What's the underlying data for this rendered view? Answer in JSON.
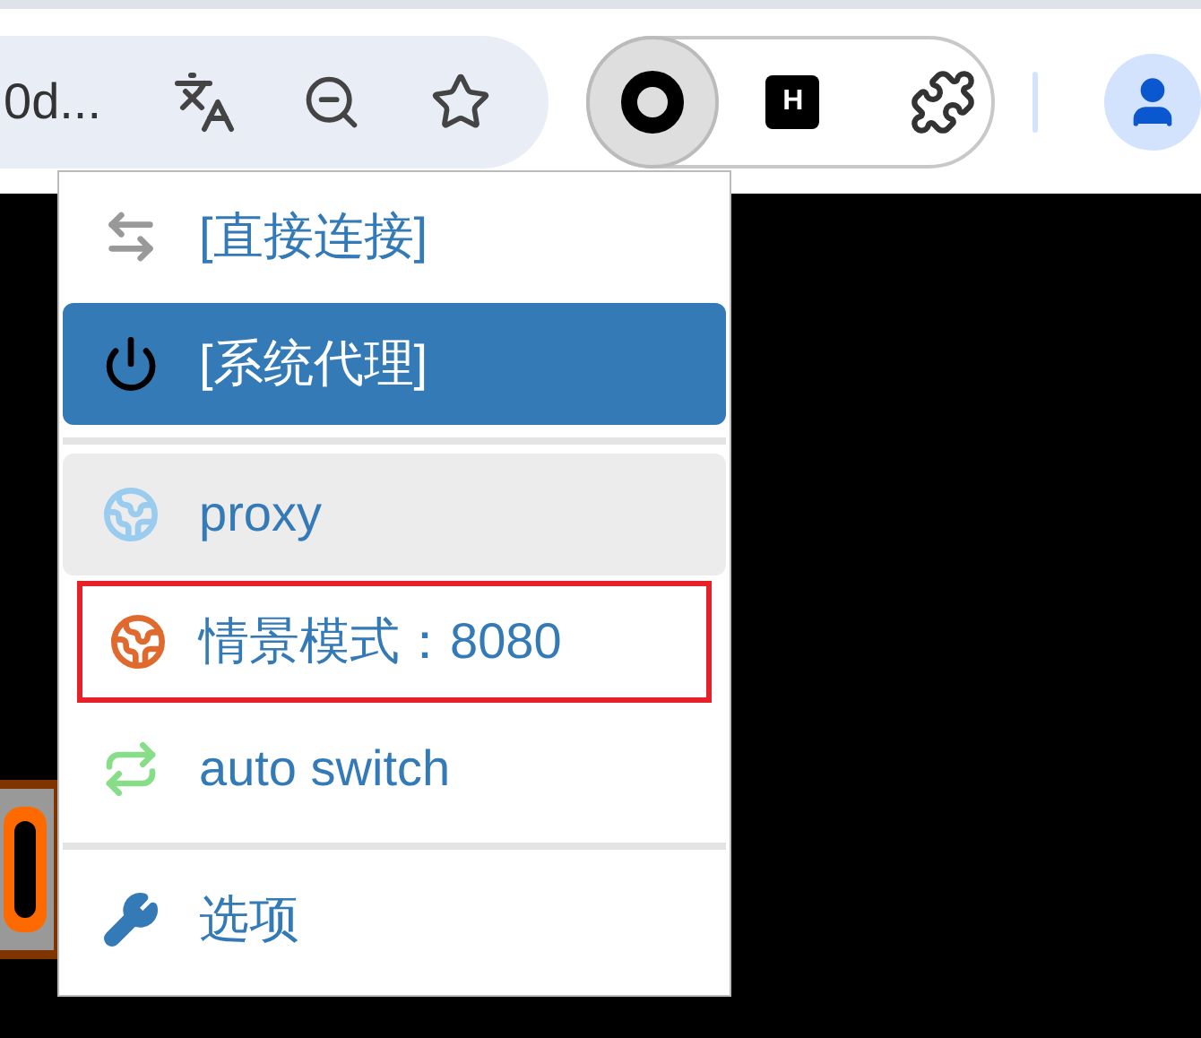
{
  "toolbar": {
    "address_text": "0d...",
    "extension_badge": "H"
  },
  "menu": {
    "sections": [
      [
        {
          "label": "[直接连接]",
          "kind": "exchange",
          "color": "#999999",
          "selected": false,
          "hovered": false,
          "outlined": false
        },
        {
          "label": "[系统代理]",
          "kind": "power",
          "color": "#000000",
          "selected": true,
          "hovered": false,
          "outlined": false
        }
      ],
      [
        {
          "label": "proxy",
          "kind": "globe",
          "color": "#99ccee",
          "selected": false,
          "hovered": true,
          "outlined": false
        },
        {
          "label": "情景模式：8080",
          "kind": "globe",
          "color": "#e06a2e",
          "selected": false,
          "hovered": false,
          "outlined": true
        },
        {
          "label": "auto switch",
          "kind": "repeat",
          "color": "#88dd88",
          "selected": false,
          "hovered": false,
          "outlined": false
        }
      ],
      [
        {
          "label": "选项",
          "kind": "wrench",
          "color": "#337ab7",
          "selected": false,
          "hovered": false,
          "outlined": false
        }
      ]
    ]
  }
}
